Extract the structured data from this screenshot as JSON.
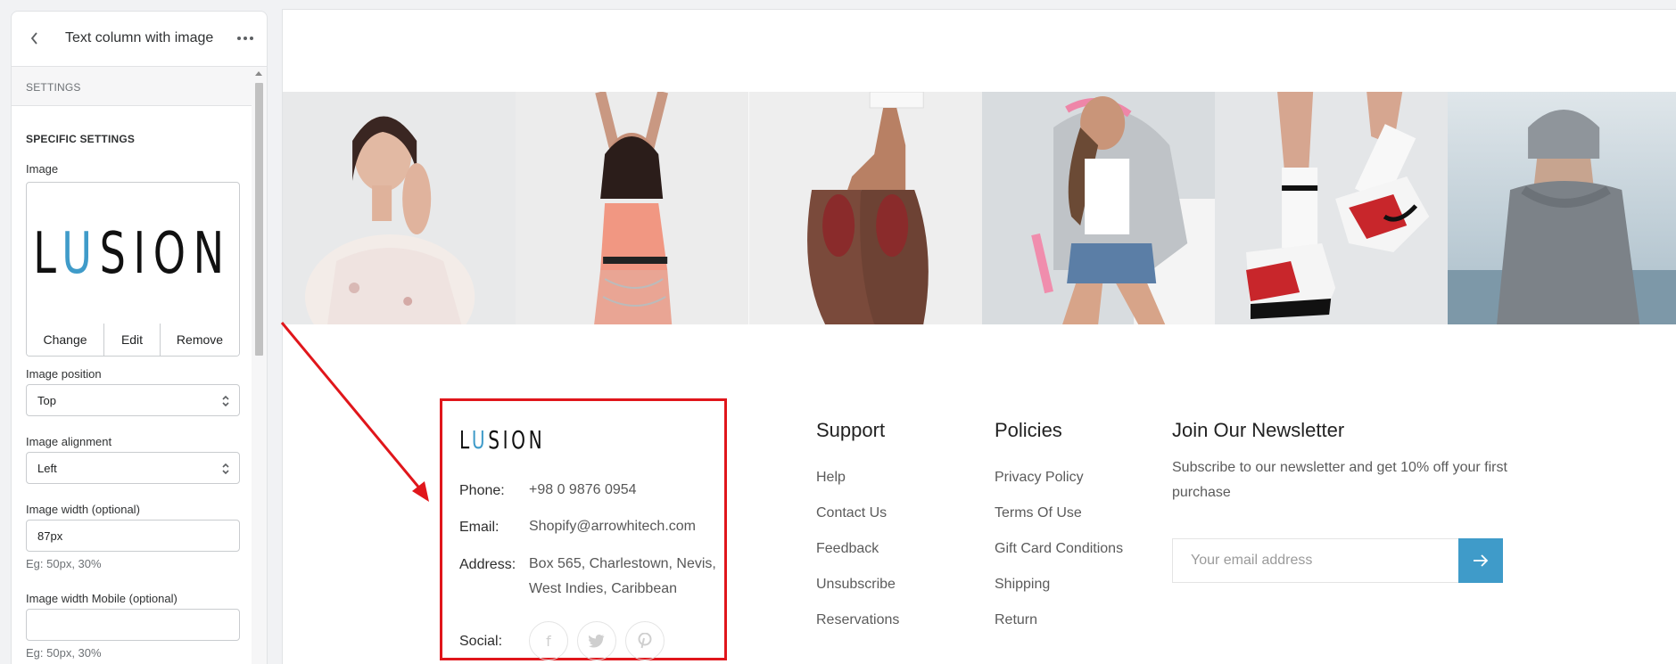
{
  "panel": {
    "title": "Text column with image",
    "settings_label": "SETTINGS",
    "section_title": "SPECIFIC SETTINGS",
    "image_label": "Image",
    "image_logo": "LUSION",
    "change_label": "Change",
    "edit_label": "Edit",
    "remove_label": "Remove",
    "image_position_label": "Image position",
    "image_position_value": "Top",
    "image_alignment_label": "Image alignment",
    "image_alignment_value": "Left",
    "image_width_label": "Image width (optional)",
    "image_width_value": "87px",
    "image_width_hint": "Eg: 50px, 30%",
    "image_width_mobile_label": "Image width Mobile (optional)",
    "image_width_mobile_value": "",
    "image_width_mobile_hint": "Eg: 50px, 30%"
  },
  "footer": {
    "logo_l": "L",
    "logo_u": "U",
    "logo_rest": "SION",
    "phone_label": "Phone:",
    "phone_value": "+98 0 9876 0954",
    "email_label": "Email:",
    "email_value": "Shopify@arrowhitech.com",
    "address_label": "Address:",
    "address_line1": "Box 565, Charlestown, Nevis,",
    "address_line2": "West Indies, Caribbean",
    "social_label": "Social:",
    "social_icons": [
      "facebook-icon",
      "twitter-icon",
      "pinterest-icon"
    ]
  },
  "support": {
    "heading": "Support",
    "links": [
      "Help",
      "Contact Us",
      "Feedback",
      "Unsubscribe",
      "Reservations"
    ]
  },
  "policies": {
    "heading": "Policies",
    "links": [
      "Privacy Policy",
      "Terms Of Use",
      "Gift Card Conditions",
      "Shipping",
      "Return"
    ]
  },
  "newsletter": {
    "heading": "Join Our Newsletter",
    "text": "Subscribe to our newsletter and get 10% off your first purchase",
    "placeholder": "Your email address"
  },
  "gallery": [
    "woman-floral-blouse-photo",
    "woman-coral-dress-photo",
    "hand-holding-shoes-photo",
    "woman-hoodie-shorts-photo",
    "sneakers-red-socks-photo",
    "person-grey-beanie-photo"
  ],
  "colors": {
    "accent": "#3f9bc9",
    "highlight_box": "#e0161b"
  }
}
